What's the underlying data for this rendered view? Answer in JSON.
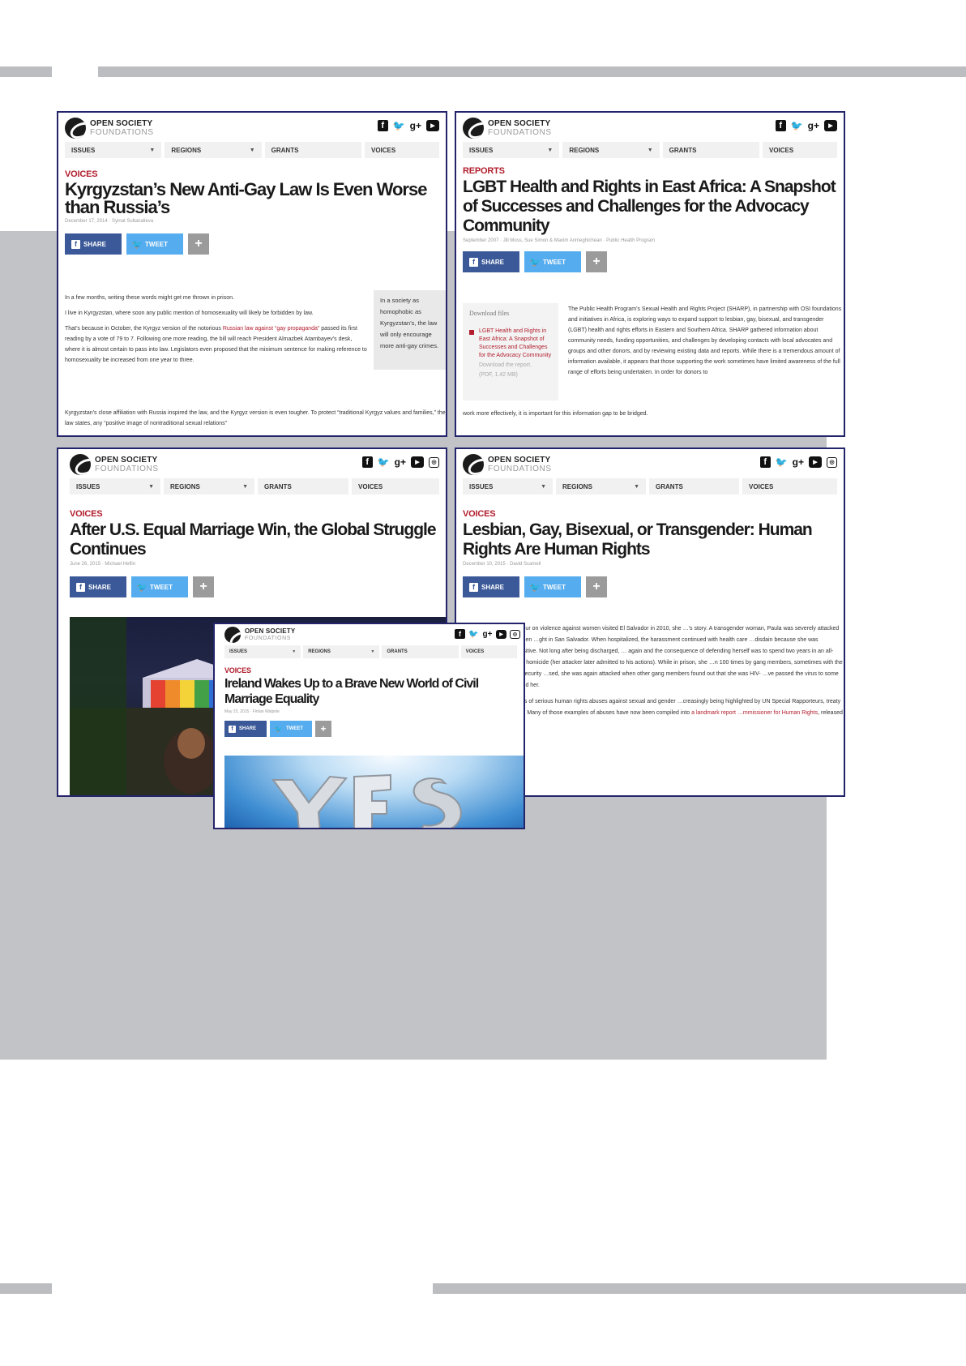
{
  "site": {
    "logo_top": "OPEN SOCIETY",
    "logo_sub": "FOUNDATIONS",
    "nav": [
      "ISSUES",
      "REGIONS",
      "GRANTS",
      "VOICES"
    ],
    "social_icons": [
      "facebook-icon",
      "twitter-icon",
      "google-plus-icon",
      "youtube-icon",
      "instagram-icon"
    ],
    "share_label": "SHARE",
    "tweet_label": "TWEET",
    "plus_label": "+",
    "colors": {
      "frame": "#24246a",
      "section": "#b11d2c",
      "facebook": "#3b5998",
      "twitter": "#55acee",
      "panel": "#c2c3c6"
    }
  },
  "articles": [
    {
      "section": "VOICES",
      "title": "Kyrgyzstan’s New Anti-Gay Law Is Even Worse than Russia’s",
      "byline": "December 17, 2014 · Syinat Sultanalieva",
      "paragraphs": [
        "In a few months, writing these words might get me thrown in prison.",
        "I live in Kyrgyzstan, where soon any public mention of homosexuality will likely be forbidden by law."
      ],
      "p3_before": "That’s because in October, the Kyrgyz version of the notorious ",
      "p3_link": "Russian law against “gay propaganda”",
      "p3_after": " passed its first reading by a vote of 79 to 7. Following one more reading, the bill will reach President Almazbek Atambayev’s desk, where it is almost certain to pass into law. Legislators even proposed that the minimum sentence for making reference to homosexuality be increased from one year to three.",
      "p4": "Kyrgyzstan’s close affiliation with Russia inspired the law, and the Kyrgyz version is even tougher. To protect “traditional Kyrgyz values and families,” the law states, any “positive image of nontraditional sexual relations”",
      "pullquote": "In a society as homophobic as Kyrgyzstan’s, the law will only encourage more anti-gay crimes."
    },
    {
      "section": "REPORTS",
      "title": "LGBT Health and Rights in East Africa: A Snapshot of Successes and Challenges for the Advocacy Community",
      "byline": "September 2007 · Jill Moss, Sue Simon & Maxim Anmeghichean · Public Health Program",
      "download_heading": "Download files",
      "download_link": "LGBT Health and Rights in East Africa: A Snapshot of Successes and Challenges for the Advocacy Community",
      "download_sub": "Download the report.",
      "download_meta": "(PDF, 1.42 MB)",
      "body": "The Public Health Program’s Sexual Health and Rights Project (SHARP), in partnership with OSI foundations and initiatives in Africa, is exploring ways to expand support to lesbian, gay, bisexual, and transgender (LGBT) health and rights efforts in Eastern and Southern Africa. SHARP gathered information about community needs, funding opportunities, and challenges by developing contacts with local advocates and groups and other donors, and by reviewing existing data and reports. While there is a tremendous amount of information available, it appears that those supporting the work sometimes have limited awareness of the full range of efforts being undertaken. In order for donors to",
      "body_tail": "work more effectively, it is important for this information gap to be bridged."
    },
    {
      "section": "VOICES",
      "title": "After U.S. Equal Marriage Win, the Global Struggle Continues",
      "byline": "June 26, 2015 · Michael Heflin"
    },
    {
      "section": "VOICES",
      "title": "Lesbian, Gay, Bisexual, or Transgender: Human Rights Are Human Rights",
      "byline": "December 10, 2015 · David Scamell",
      "p1": "…tions Special Rapporteur on violence against women visited El Salvador in 2010, she …’s story. A transgender woman, Paula was severely attacked and shot by a group of men …ght in San Salvador. When hospitalized, the harassment continued with health care …disdain because she was transgender and HIV-positive. Not long after being discharged, … again and the consequence of defending herself was to spend two years in an all-male …ges of attempted homicide (her attacker later admitted to his actions). While in prison, she …n 100 times by gang members, sometimes with the complicity of the prison security …sed, she was again attacked when other gang members found out that she was HIV- …ve passed the virus to some of the men who had raped her.",
      "p2_before": "… one of many examples of serious human rights abuses against sexual and gender …creasingly being highlighted by UN Special Rapporteurs, treaty bodies, and the UN …cil. Many of those examples of abuses have now been compiled into ",
      "p2_link": "a landmark report …mmissioner for Human Rights",
      "p2_after": ", released yesterday."
    },
    {
      "section": "VOICES",
      "title": "Ireland Wakes Up to a Brave New World of Civil Marriage Equality",
      "byline": "May 23, 2015 · Fintan Walpole"
    }
  ]
}
